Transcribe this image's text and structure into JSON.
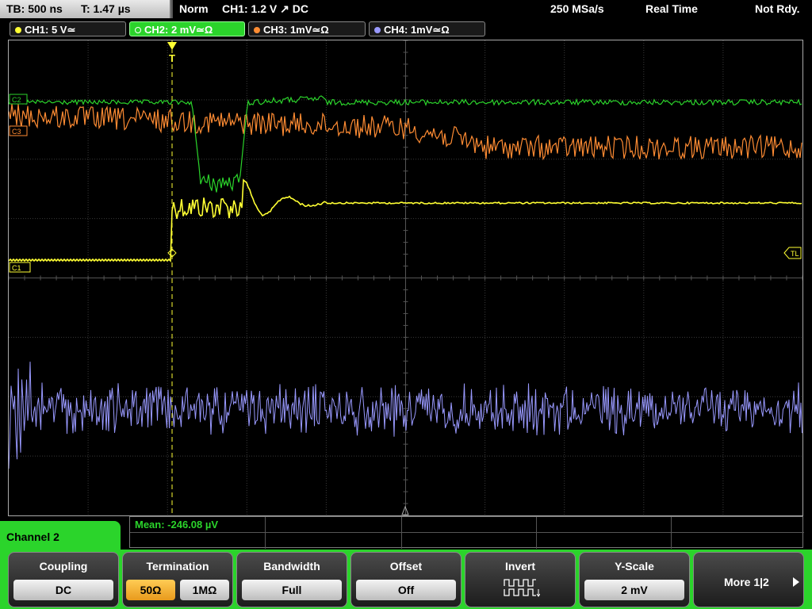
{
  "top_bar": {
    "timebase": "TB: 500 ns",
    "trigger_time": "T: 1.47 µs",
    "trigger_mode": "Norm",
    "trigger_info": "CH1: 1.2 V ↗ DC",
    "sample_rate": "250 MSa/s",
    "acq_mode": "Real Time",
    "status": "Not Rdy."
  },
  "channels": [
    {
      "label": "CH1: 5 V≃",
      "color": "#ffff33"
    },
    {
      "label": "CH2: 2 mV≃Ω",
      "color": "#2bd42b",
      "active": true
    },
    {
      "label": "CH3: 1mV≃Ω",
      "color": "#ff8c33"
    },
    {
      "label": "CH4: 1mV≃Ω",
      "color": "#9999ff"
    }
  ],
  "markers": {
    "ch1": "C1",
    "ch2": "C2",
    "ch3": "C3",
    "trigger_level": "TL",
    "trigger": "T"
  },
  "measurement": {
    "mean": "Mean: -246.08 µV"
  },
  "channel_panel": {
    "title": "Channel 2"
  },
  "softkeys": {
    "coupling": {
      "title": "Coupling",
      "value": "DC"
    },
    "termination": {
      "title": "Termination",
      "opt1": "50Ω",
      "opt2": "1MΩ"
    },
    "bandwidth": {
      "title": "Bandwidth",
      "value": "Full"
    },
    "offset": {
      "title": "Offset",
      "value": "Off"
    },
    "invert": {
      "title": "Invert",
      "icon": "invert-wave-icon"
    },
    "yscale": {
      "title": "Y-Scale",
      "value": "2 mV"
    },
    "more": {
      "label": "More 1|2"
    }
  },
  "colors": {
    "ch1": "#ffff33",
    "ch2": "#2bd42b",
    "ch3": "#ff8c33",
    "ch4": "#9999ff",
    "accent": "#2bd42b"
  }
}
